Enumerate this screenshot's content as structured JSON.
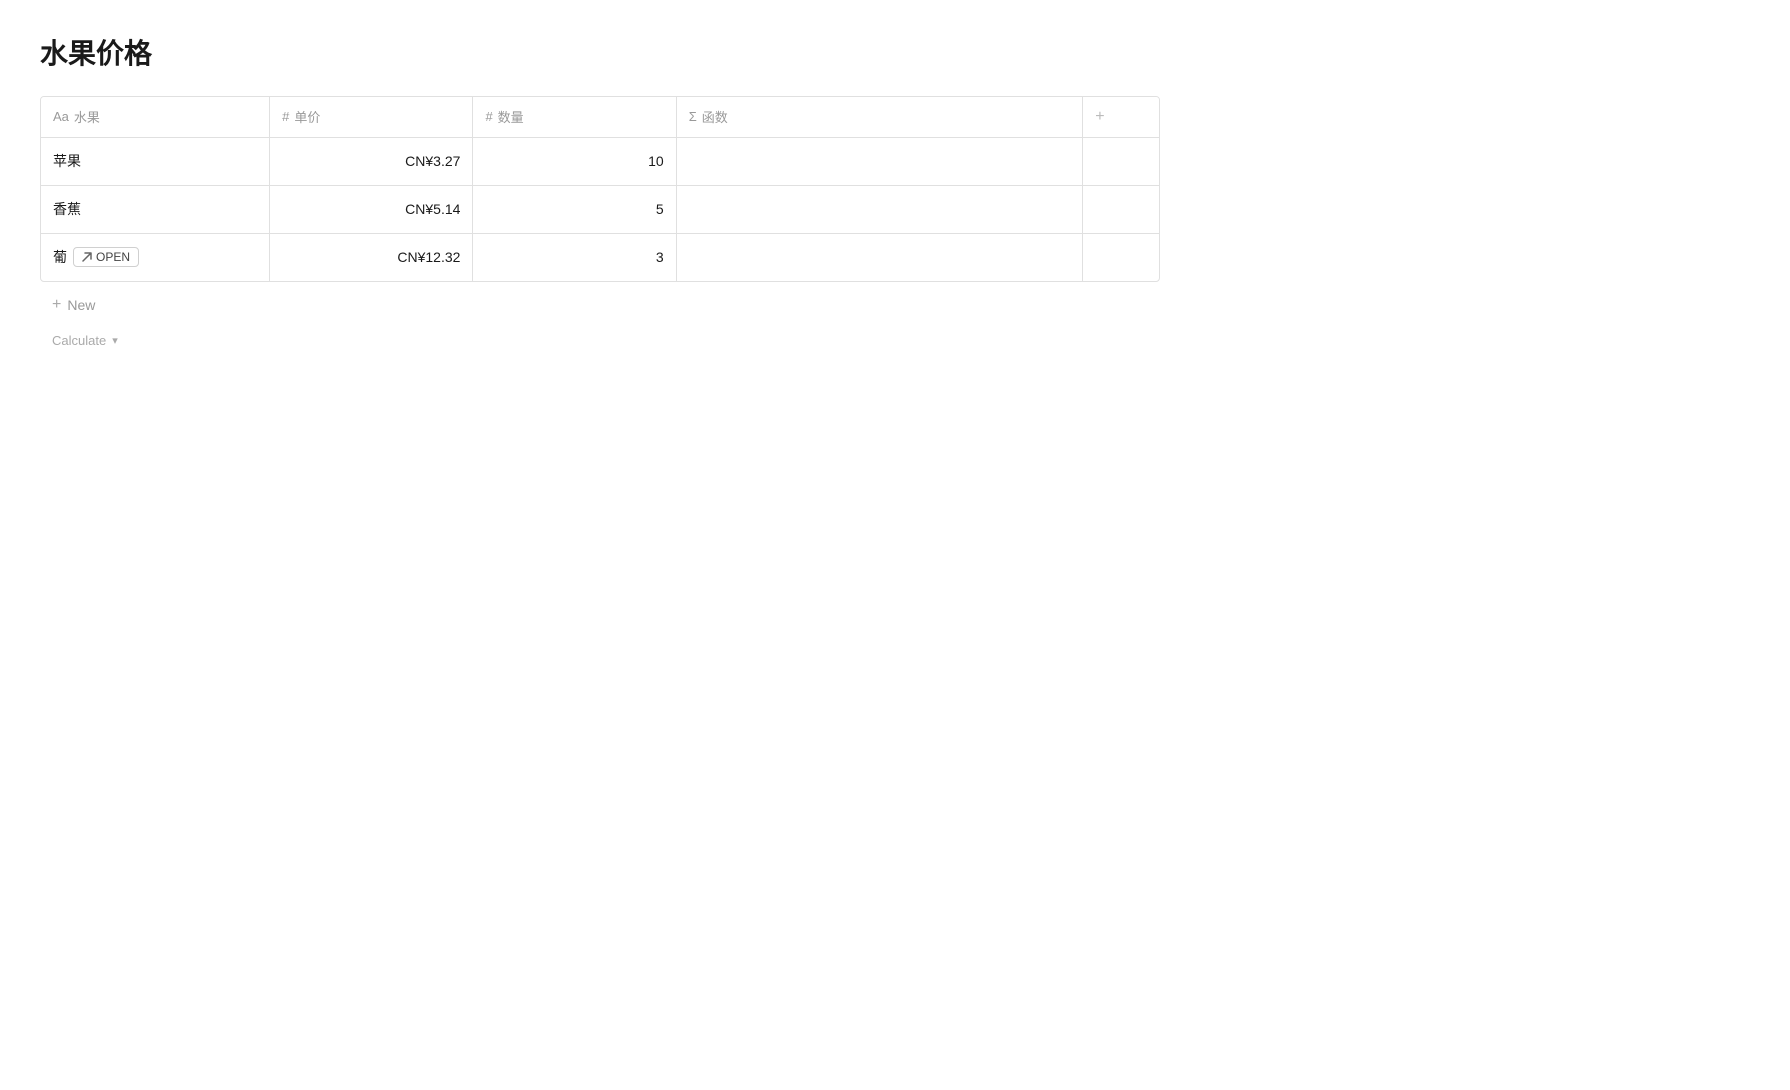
{
  "page": {
    "title": "水果价格"
  },
  "table": {
    "columns": [
      {
        "id": "name",
        "icon": "Aa",
        "icon_type": "text",
        "label": "水果"
      },
      {
        "id": "price",
        "icon": "#",
        "icon_type": "number",
        "label": "单价"
      },
      {
        "id": "qty",
        "icon": "#",
        "icon_type": "number",
        "label": "数量"
      },
      {
        "id": "func",
        "icon": "Σ",
        "icon_type": "formula",
        "label": "函数"
      },
      {
        "id": "add",
        "icon": "+",
        "label": ""
      }
    ],
    "rows": [
      {
        "id": "row-1",
        "name": "苹果",
        "price": "CN¥3.27",
        "qty": "10",
        "func": "",
        "hovered": false
      },
      {
        "id": "row-2",
        "name": "香蕉",
        "price": "CN¥5.14",
        "qty": "5",
        "func": "",
        "hovered": false
      },
      {
        "id": "row-3",
        "name": "葡",
        "price": "CN¥12.32",
        "qty": "3",
        "func": "",
        "hovered": true,
        "open_button": "OPEN"
      }
    ],
    "add_new_label": "New",
    "calculate_label": "Calculate"
  }
}
